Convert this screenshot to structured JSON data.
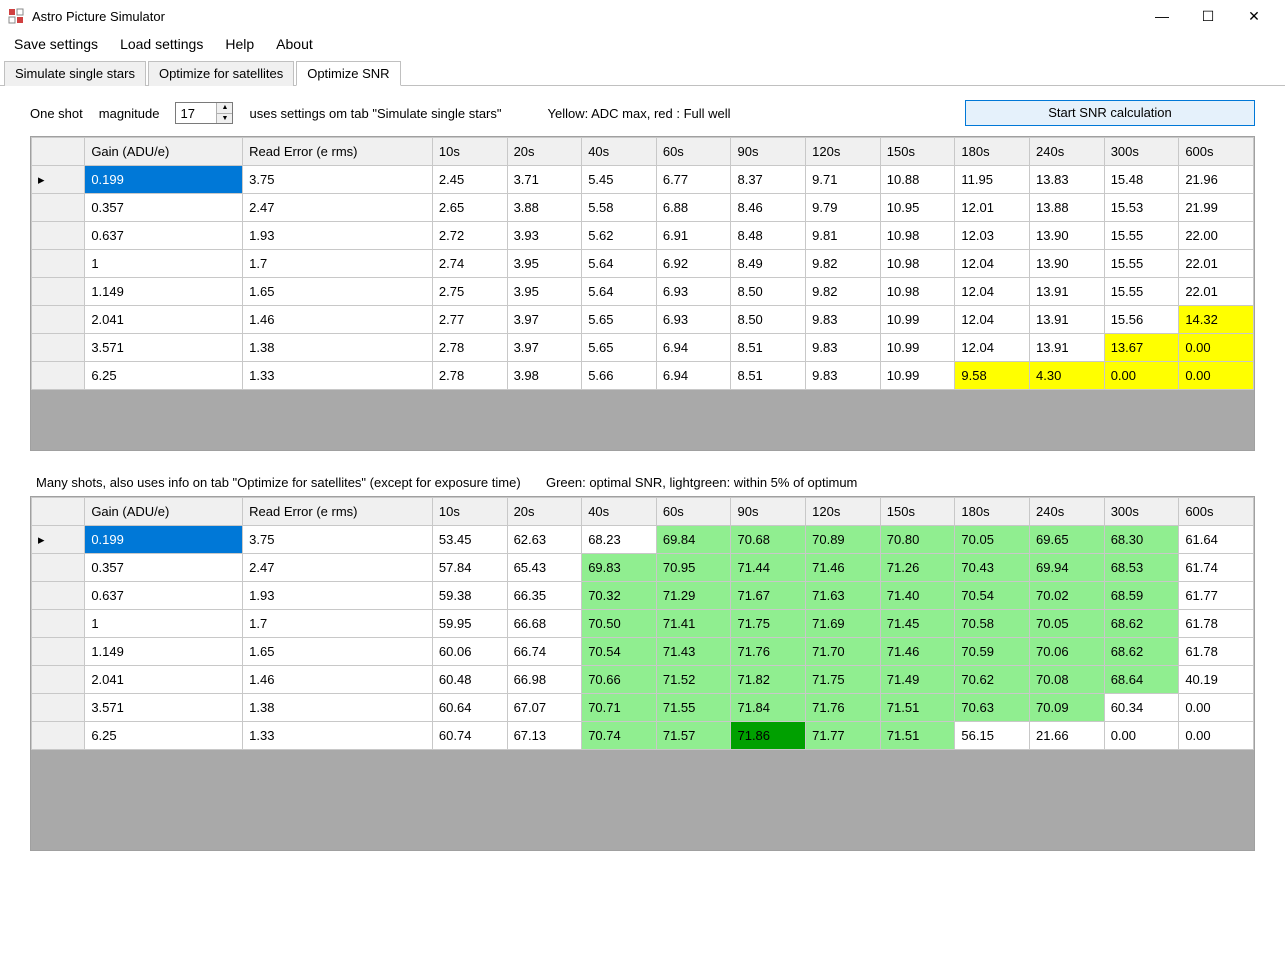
{
  "window": {
    "title": "Astro Picture Simulator"
  },
  "menu": {
    "save": "Save settings",
    "load": "Load settings",
    "help": "Help",
    "about": "About"
  },
  "tabs": {
    "t1": "Simulate single stars",
    "t2": "Optimize for satellites",
    "t3": "Optimize SNR"
  },
  "toprow": {
    "one_shot": "One shot",
    "magnitude_label": "magnitude",
    "magnitude_value": "17",
    "uses": "uses settings om tab \"Simulate single stars\"",
    "legend": "Yellow: ADC max, red : Full well",
    "start_btn": "Start SNR calculation"
  },
  "headers": [
    "Gain (ADU/e)",
    "Read Error (e rms)",
    "10s",
    "20s",
    "40s",
    "60s",
    "90s",
    "120s",
    "150s",
    "180s",
    "240s",
    "300s",
    "600s"
  ],
  "table1": {
    "rows": [
      {
        "gain": "0.199",
        "read": "3.75",
        "v": [
          "2.45",
          "3.71",
          "5.45",
          "6.77",
          "8.37",
          "9.71",
          "10.88",
          "11.95",
          "13.83",
          "15.48",
          "21.96"
        ],
        "hl": {}
      },
      {
        "gain": "0.357",
        "read": "2.47",
        "v": [
          "2.65",
          "3.88",
          "5.58",
          "6.88",
          "8.46",
          "9.79",
          "10.95",
          "12.01",
          "13.88",
          "15.53",
          "21.99"
        ],
        "hl": {}
      },
      {
        "gain": "0.637",
        "read": "1.93",
        "v": [
          "2.72",
          "3.93",
          "5.62",
          "6.91",
          "8.48",
          "9.81",
          "10.98",
          "12.03",
          "13.90",
          "15.55",
          "22.00"
        ],
        "hl": {}
      },
      {
        "gain": "1",
        "read": "1.7",
        "v": [
          "2.74",
          "3.95",
          "5.64",
          "6.92",
          "8.49",
          "9.82",
          "10.98",
          "12.04",
          "13.90",
          "15.55",
          "22.01"
        ],
        "hl": {}
      },
      {
        "gain": "1.149",
        "read": "1.65",
        "v": [
          "2.75",
          "3.95",
          "5.64",
          "6.93",
          "8.50",
          "9.82",
          "10.98",
          "12.04",
          "13.91",
          "15.55",
          "22.01"
        ],
        "hl": {}
      },
      {
        "gain": "2.041",
        "read": "1.46",
        "v": [
          "2.77",
          "3.97",
          "5.65",
          "6.93",
          "8.50",
          "9.83",
          "10.99",
          "12.04",
          "13.91",
          "15.56",
          "14.32"
        ],
        "hl": {
          "10": "yellow"
        }
      },
      {
        "gain": "3.571",
        "read": "1.38",
        "v": [
          "2.78",
          "3.97",
          "5.65",
          "6.94",
          "8.51",
          "9.83",
          "10.99",
          "12.04",
          "13.91",
          "13.67",
          "0.00"
        ],
        "hl": {
          "9": "yellow",
          "10": "yellow"
        }
      },
      {
        "gain": "6.25",
        "read": "1.33",
        "v": [
          "2.78",
          "3.98",
          "5.66",
          "6.94",
          "8.51",
          "9.83",
          "10.99",
          "9.58",
          "4.30",
          "0.00",
          "0.00"
        ],
        "hl": {
          "7": "yellow",
          "8": "yellow",
          "9": "yellow",
          "10": "yellow"
        }
      }
    ]
  },
  "mid_desc": "Many shots, also uses info on tab \"Optimize for satellites\" (except for exposure time)",
  "mid_legend": "Green: optimal SNR, lightgreen: within 5% of optimum",
  "table2": {
    "rows": [
      {
        "gain": "0.199",
        "read": "3.75",
        "v": [
          "53.45",
          "62.63",
          "68.23",
          "69.84",
          "70.68",
          "70.89",
          "70.80",
          "70.05",
          "69.65",
          "68.30",
          "61.64"
        ],
        "hl": {
          "3": "lightgreen",
          "4": "lightgreen",
          "5": "lightgreen",
          "6": "lightgreen",
          "7": "lightgreen",
          "8": "lightgreen",
          "9": "lightgreen"
        }
      },
      {
        "gain": "0.357",
        "read": "2.47",
        "v": [
          "57.84",
          "65.43",
          "69.83",
          "70.95",
          "71.44",
          "71.46",
          "71.26",
          "70.43",
          "69.94",
          "68.53",
          "61.74"
        ],
        "hl": {
          "2": "lightgreen",
          "3": "lightgreen",
          "4": "lightgreen",
          "5": "lightgreen",
          "6": "lightgreen",
          "7": "lightgreen",
          "8": "lightgreen",
          "9": "lightgreen"
        }
      },
      {
        "gain": "0.637",
        "read": "1.93",
        "v": [
          "59.38",
          "66.35",
          "70.32",
          "71.29",
          "71.67",
          "71.63",
          "71.40",
          "70.54",
          "70.02",
          "68.59",
          "61.77"
        ],
        "hl": {
          "2": "lightgreen",
          "3": "lightgreen",
          "4": "lightgreen",
          "5": "lightgreen",
          "6": "lightgreen",
          "7": "lightgreen",
          "8": "lightgreen",
          "9": "lightgreen"
        }
      },
      {
        "gain": "1",
        "read": "1.7",
        "v": [
          "59.95",
          "66.68",
          "70.50",
          "71.41",
          "71.75",
          "71.69",
          "71.45",
          "70.58",
          "70.05",
          "68.62",
          "61.78"
        ],
        "hl": {
          "2": "lightgreen",
          "3": "lightgreen",
          "4": "lightgreen",
          "5": "lightgreen",
          "6": "lightgreen",
          "7": "lightgreen",
          "8": "lightgreen",
          "9": "lightgreen"
        }
      },
      {
        "gain": "1.149",
        "read": "1.65",
        "v": [
          "60.06",
          "66.74",
          "70.54",
          "71.43",
          "71.76",
          "71.70",
          "71.46",
          "70.59",
          "70.06",
          "68.62",
          "61.78"
        ],
        "hl": {
          "2": "lightgreen",
          "3": "lightgreen",
          "4": "lightgreen",
          "5": "lightgreen",
          "6": "lightgreen",
          "7": "lightgreen",
          "8": "lightgreen",
          "9": "lightgreen"
        }
      },
      {
        "gain": "2.041",
        "read": "1.46",
        "v": [
          "60.48",
          "66.98",
          "70.66",
          "71.52",
          "71.82",
          "71.75",
          "71.49",
          "70.62",
          "70.08",
          "68.64",
          "40.19"
        ],
        "hl": {
          "2": "lightgreen",
          "3": "lightgreen",
          "4": "lightgreen",
          "5": "lightgreen",
          "6": "lightgreen",
          "7": "lightgreen",
          "8": "lightgreen",
          "9": "lightgreen"
        }
      },
      {
        "gain": "3.571",
        "read": "1.38",
        "v": [
          "60.64",
          "67.07",
          "70.71",
          "71.55",
          "71.84",
          "71.76",
          "71.51",
          "70.63",
          "70.09",
          "60.34",
          "0.00"
        ],
        "hl": {
          "2": "lightgreen",
          "3": "lightgreen",
          "4": "lightgreen",
          "5": "lightgreen",
          "6": "lightgreen",
          "7": "lightgreen",
          "8": "lightgreen"
        }
      },
      {
        "gain": "6.25",
        "read": "1.33",
        "v": [
          "60.74",
          "67.13",
          "70.74",
          "71.57",
          "71.86",
          "71.77",
          "71.51",
          "56.15",
          "21.66",
          "0.00",
          "0.00"
        ],
        "hl": {
          "2": "lightgreen",
          "3": "lightgreen",
          "4": "green",
          "5": "lightgreen",
          "6": "lightgreen"
        }
      }
    ]
  }
}
